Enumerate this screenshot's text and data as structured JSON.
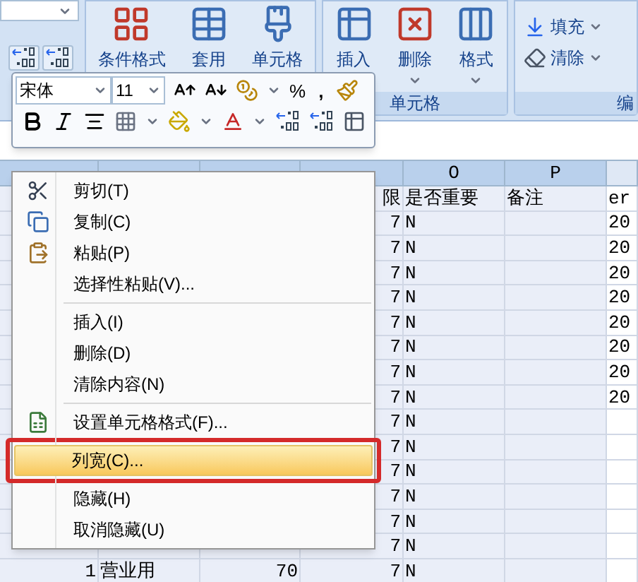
{
  "ribbon": {
    "groups": [
      {
        "kind": "styles",
        "buttons": [
          {
            "label": "条件格式"
          },
          {
            "label": "套用"
          },
          {
            "label": "单元格"
          }
        ]
      },
      {
        "kind": "cells",
        "label": "单元格",
        "buttons": [
          {
            "label": "插入"
          },
          {
            "label": "删除"
          },
          {
            "label": "格式"
          }
        ]
      },
      {
        "kind": "editing",
        "label": "编",
        "items": [
          {
            "label": "填充"
          },
          {
            "label": "清除"
          }
        ]
      }
    ]
  },
  "mini_toolbar": {
    "font": "宋体",
    "size": "11",
    "percent": "%",
    "comma": ","
  },
  "columns": {
    "c5": "O",
    "c6": "P"
  },
  "rows": [
    {
      "c4": "限",
      "c5": "是否重要",
      "c6": "备注",
      "c7": "er"
    },
    {
      "c4": "7",
      "c5": "N",
      "c7": "20"
    },
    {
      "c4": "7",
      "c5": "N",
      "c7": "20"
    },
    {
      "c4": "7",
      "c5": "N",
      "c7": "20"
    },
    {
      "c4": "7",
      "c5": "N",
      "c7": "20"
    },
    {
      "c4": "7",
      "c5": "N",
      "c7": "20"
    },
    {
      "c4": "7",
      "c5": "N",
      "c7": "20"
    },
    {
      "c4": "7",
      "c5": "N",
      "c7": "20"
    },
    {
      "c4": "7",
      "c5": "N",
      "c7": "20"
    },
    {
      "c4": "7",
      "c5": "N"
    },
    {
      "c4": "7",
      "c5": "N"
    },
    {
      "c4": "7",
      "c5": "N"
    },
    {
      "c4": "7",
      "c5": "N"
    },
    {
      "c4": "7",
      "c5": "N"
    },
    {
      "c4": "7",
      "c5": "N"
    },
    {
      "c1": "1",
      "c2": "营业用",
      "c3": "70",
      "c4": "7",
      "c5": "N"
    }
  ],
  "context_menu": [
    {
      "kind": "item",
      "label": "剪切(T)",
      "selected": false,
      "outlined": false
    },
    {
      "kind": "item",
      "label": "复制(C)",
      "selected": false,
      "outlined": false
    },
    {
      "kind": "item",
      "label": "粘贴(P)",
      "selected": false,
      "outlined": false
    },
    {
      "kind": "item",
      "label": "选择性粘贴(V)...",
      "selected": false,
      "outlined": false
    },
    {
      "kind": "separator"
    },
    {
      "kind": "item",
      "label": "插入(I)",
      "selected": false,
      "outlined": false
    },
    {
      "kind": "item",
      "label": "删除(D)",
      "selected": false,
      "outlined": false
    },
    {
      "kind": "item",
      "label": "清除内容(N)",
      "selected": false,
      "outlined": false
    },
    {
      "kind": "separator"
    },
    {
      "kind": "item",
      "label": "设置单元格格式(F)...",
      "selected": false,
      "outlined": false
    },
    {
      "kind": "item",
      "label": "列宽(C)...",
      "selected": true,
      "outlined": true
    },
    {
      "kind": "item",
      "label": "隐藏(H)",
      "selected": false,
      "outlined": false
    },
    {
      "kind": "item",
      "label": "取消隐藏(U)",
      "selected": false,
      "outlined": false
    }
  ]
}
